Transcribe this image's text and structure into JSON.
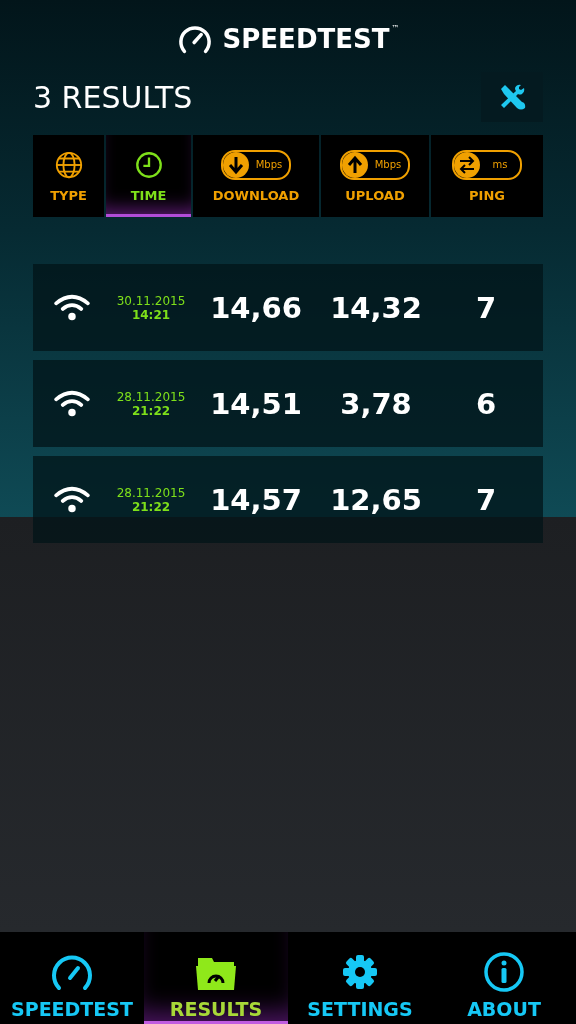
{
  "app": {
    "title": "SPEEDTEST",
    "trademark": "™"
  },
  "results_count": "3 RESULTS",
  "sort_columns": [
    {
      "kind": "type",
      "label": "TYPE",
      "selected": false
    },
    {
      "kind": "time",
      "label": "TIME",
      "selected": true
    },
    {
      "kind": "download",
      "label": "DOWNLOAD",
      "unit": "Mbps",
      "selected": false
    },
    {
      "kind": "upload",
      "label": "UPLOAD",
      "unit": "Mbps",
      "selected": false
    },
    {
      "kind": "ping",
      "label": "PING",
      "unit": "ms",
      "selected": false
    }
  ],
  "results": [
    {
      "date": "30.11.2015",
      "time": "14:21",
      "download": "14,66",
      "upload": "14,32",
      "ping": "7"
    },
    {
      "date": "28.11.2015",
      "time": "21:22",
      "download": "14,51",
      "upload": "3,78",
      "ping": "6"
    },
    {
      "date": "28.11.2015",
      "time": "21:22",
      "download": "14,57",
      "upload": "12,65",
      "ping": "7"
    }
  ],
  "nav": [
    {
      "kind": "speedtest",
      "label": "SPEEDTEST",
      "selected": false
    },
    {
      "kind": "results",
      "label": "RESULTS",
      "selected": true
    },
    {
      "kind": "settings",
      "label": "SETTINGS",
      "selected": false
    },
    {
      "kind": "about",
      "label": "ABOUT",
      "selected": false
    }
  ]
}
